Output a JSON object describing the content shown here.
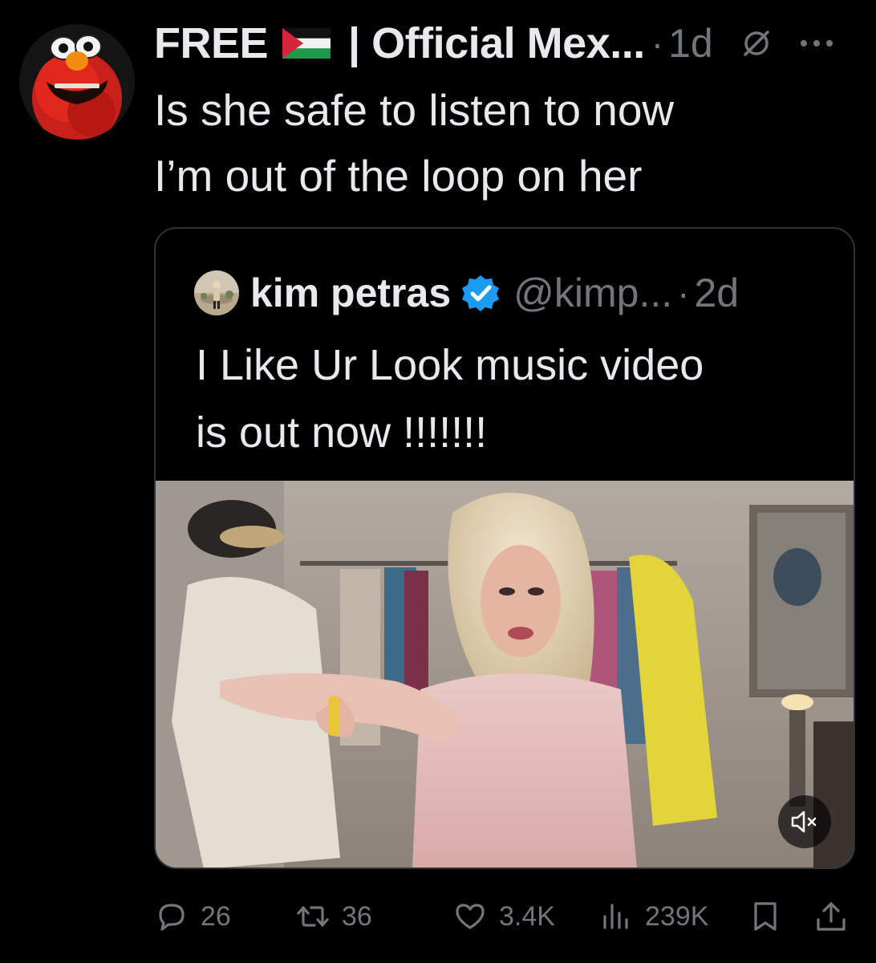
{
  "tweet": {
    "author": {
      "display_name_prefix": "FREE",
      "display_name_suffix": "| Official Mex...",
      "flag_icon": "palestine-flag-icon",
      "avatar_icon": "elmo-avatar"
    },
    "separator": "·",
    "timestamp": "1d",
    "text": "Is she safe to listen to now\nI’m out of the loop on her",
    "quote": {
      "author_name": "kim petras",
      "verified": true,
      "handle": "@kimp...",
      "separator": "·",
      "timestamp": "2d",
      "text": "I Like Ur Look music video\nis out now !!!!!!!",
      "video": {
        "muted": true
      }
    },
    "metrics": {
      "replies": "26",
      "retweets": "36",
      "likes": "3.4K",
      "views": "239K"
    }
  },
  "colors": {
    "background": "#000000",
    "primary_text": "#e7e9ea",
    "secondary_text": "#71767b",
    "border": "#2f3336",
    "verified_blue": "#1d9bf0"
  }
}
